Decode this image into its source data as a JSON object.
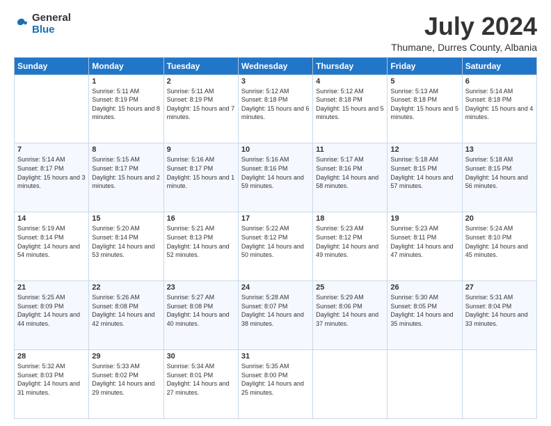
{
  "logo": {
    "general": "General",
    "blue": "Blue"
  },
  "header": {
    "month": "July 2024",
    "location": "Thumane, Durres County, Albania"
  },
  "weekdays": [
    "Sunday",
    "Monday",
    "Tuesday",
    "Wednesday",
    "Thursday",
    "Friday",
    "Saturday"
  ],
  "weeks": [
    [
      {
        "day": "",
        "sunrise": "",
        "sunset": "",
        "daylight": ""
      },
      {
        "day": "1",
        "sunrise": "Sunrise: 5:11 AM",
        "sunset": "Sunset: 8:19 PM",
        "daylight": "Daylight: 15 hours and 8 minutes."
      },
      {
        "day": "2",
        "sunrise": "Sunrise: 5:11 AM",
        "sunset": "Sunset: 8:19 PM",
        "daylight": "Daylight: 15 hours and 7 minutes."
      },
      {
        "day": "3",
        "sunrise": "Sunrise: 5:12 AM",
        "sunset": "Sunset: 8:18 PM",
        "daylight": "Daylight: 15 hours and 6 minutes."
      },
      {
        "day": "4",
        "sunrise": "Sunrise: 5:12 AM",
        "sunset": "Sunset: 8:18 PM",
        "daylight": "Daylight: 15 hours and 5 minutes."
      },
      {
        "day": "5",
        "sunrise": "Sunrise: 5:13 AM",
        "sunset": "Sunset: 8:18 PM",
        "daylight": "Daylight: 15 hours and 5 minutes."
      },
      {
        "day": "6",
        "sunrise": "Sunrise: 5:14 AM",
        "sunset": "Sunset: 8:18 PM",
        "daylight": "Daylight: 15 hours and 4 minutes."
      }
    ],
    [
      {
        "day": "7",
        "sunrise": "Sunrise: 5:14 AM",
        "sunset": "Sunset: 8:17 PM",
        "daylight": "Daylight: 15 hours and 3 minutes."
      },
      {
        "day": "8",
        "sunrise": "Sunrise: 5:15 AM",
        "sunset": "Sunset: 8:17 PM",
        "daylight": "Daylight: 15 hours and 2 minutes."
      },
      {
        "day": "9",
        "sunrise": "Sunrise: 5:16 AM",
        "sunset": "Sunset: 8:17 PM",
        "daylight": "Daylight: 15 hours and 1 minute."
      },
      {
        "day": "10",
        "sunrise": "Sunrise: 5:16 AM",
        "sunset": "Sunset: 8:16 PM",
        "daylight": "Daylight: 14 hours and 59 minutes."
      },
      {
        "day": "11",
        "sunrise": "Sunrise: 5:17 AM",
        "sunset": "Sunset: 8:16 PM",
        "daylight": "Daylight: 14 hours and 58 minutes."
      },
      {
        "day": "12",
        "sunrise": "Sunrise: 5:18 AM",
        "sunset": "Sunset: 8:15 PM",
        "daylight": "Daylight: 14 hours and 57 minutes."
      },
      {
        "day": "13",
        "sunrise": "Sunrise: 5:18 AM",
        "sunset": "Sunset: 8:15 PM",
        "daylight": "Daylight: 14 hours and 56 minutes."
      }
    ],
    [
      {
        "day": "14",
        "sunrise": "Sunrise: 5:19 AM",
        "sunset": "Sunset: 8:14 PM",
        "daylight": "Daylight: 14 hours and 54 minutes."
      },
      {
        "day": "15",
        "sunrise": "Sunrise: 5:20 AM",
        "sunset": "Sunset: 8:14 PM",
        "daylight": "Daylight: 14 hours and 53 minutes."
      },
      {
        "day": "16",
        "sunrise": "Sunrise: 5:21 AM",
        "sunset": "Sunset: 8:13 PM",
        "daylight": "Daylight: 14 hours and 52 minutes."
      },
      {
        "day": "17",
        "sunrise": "Sunrise: 5:22 AM",
        "sunset": "Sunset: 8:12 PM",
        "daylight": "Daylight: 14 hours and 50 minutes."
      },
      {
        "day": "18",
        "sunrise": "Sunrise: 5:23 AM",
        "sunset": "Sunset: 8:12 PM",
        "daylight": "Daylight: 14 hours and 49 minutes."
      },
      {
        "day": "19",
        "sunrise": "Sunrise: 5:23 AM",
        "sunset": "Sunset: 8:11 PM",
        "daylight": "Daylight: 14 hours and 47 minutes."
      },
      {
        "day": "20",
        "sunrise": "Sunrise: 5:24 AM",
        "sunset": "Sunset: 8:10 PM",
        "daylight": "Daylight: 14 hours and 45 minutes."
      }
    ],
    [
      {
        "day": "21",
        "sunrise": "Sunrise: 5:25 AM",
        "sunset": "Sunset: 8:09 PM",
        "daylight": "Daylight: 14 hours and 44 minutes."
      },
      {
        "day": "22",
        "sunrise": "Sunrise: 5:26 AM",
        "sunset": "Sunset: 8:08 PM",
        "daylight": "Daylight: 14 hours and 42 minutes."
      },
      {
        "day": "23",
        "sunrise": "Sunrise: 5:27 AM",
        "sunset": "Sunset: 8:08 PM",
        "daylight": "Daylight: 14 hours and 40 minutes."
      },
      {
        "day": "24",
        "sunrise": "Sunrise: 5:28 AM",
        "sunset": "Sunset: 8:07 PM",
        "daylight": "Daylight: 14 hours and 38 minutes."
      },
      {
        "day": "25",
        "sunrise": "Sunrise: 5:29 AM",
        "sunset": "Sunset: 8:06 PM",
        "daylight": "Daylight: 14 hours and 37 minutes."
      },
      {
        "day": "26",
        "sunrise": "Sunrise: 5:30 AM",
        "sunset": "Sunset: 8:05 PM",
        "daylight": "Daylight: 14 hours and 35 minutes."
      },
      {
        "day": "27",
        "sunrise": "Sunrise: 5:31 AM",
        "sunset": "Sunset: 8:04 PM",
        "daylight": "Daylight: 14 hours and 33 minutes."
      }
    ],
    [
      {
        "day": "28",
        "sunrise": "Sunrise: 5:32 AM",
        "sunset": "Sunset: 8:03 PM",
        "daylight": "Daylight: 14 hours and 31 minutes."
      },
      {
        "day": "29",
        "sunrise": "Sunrise: 5:33 AM",
        "sunset": "Sunset: 8:02 PM",
        "daylight": "Daylight: 14 hours and 29 minutes."
      },
      {
        "day": "30",
        "sunrise": "Sunrise: 5:34 AM",
        "sunset": "Sunset: 8:01 PM",
        "daylight": "Daylight: 14 hours and 27 minutes."
      },
      {
        "day": "31",
        "sunrise": "Sunrise: 5:35 AM",
        "sunset": "Sunset: 8:00 PM",
        "daylight": "Daylight: 14 hours and 25 minutes."
      },
      {
        "day": "",
        "sunrise": "",
        "sunset": "",
        "daylight": ""
      },
      {
        "day": "",
        "sunrise": "",
        "sunset": "",
        "daylight": ""
      },
      {
        "day": "",
        "sunrise": "",
        "sunset": "",
        "daylight": ""
      }
    ]
  ]
}
